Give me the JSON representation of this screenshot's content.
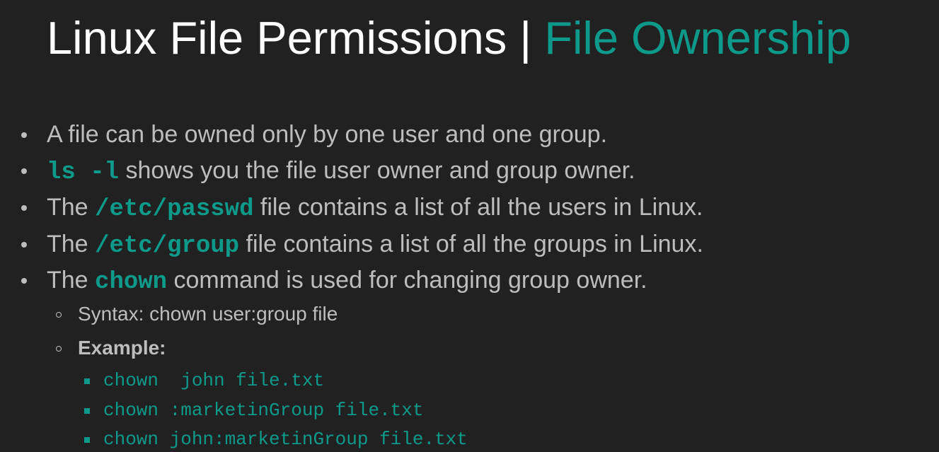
{
  "title": {
    "main": "Linux File Permissions | ",
    "accent": "File Ownership"
  },
  "bullets": {
    "b1": {
      "text": "A file can be owned only by one user and one group."
    },
    "b2": {
      "code": "ls -l",
      "text": " shows you the file user owner and group owner."
    },
    "b3": {
      "prefix": "The ",
      "code": "/etc/passwd",
      "text": " file contains a list of all the users in Linux."
    },
    "b4": {
      "prefix": "The ",
      "code": "/etc/group",
      "text": " file contains a list of all the groups in Linux."
    },
    "b5": {
      "prefix": "The ",
      "code": "chown",
      "text": " command is used for changing group owner."
    }
  },
  "sub": {
    "syntax": "Syntax: chown user:group file",
    "example": "Example:"
  },
  "examples": [
    "chown  john file.txt",
    "chown :marketinGroup file.txt",
    "chown john:marketinGroup file.txt"
  ],
  "colors": {
    "background": "#212121",
    "title": "#ffffff",
    "accent": "#0e9a8a",
    "body_text": "#bdbdbd"
  }
}
